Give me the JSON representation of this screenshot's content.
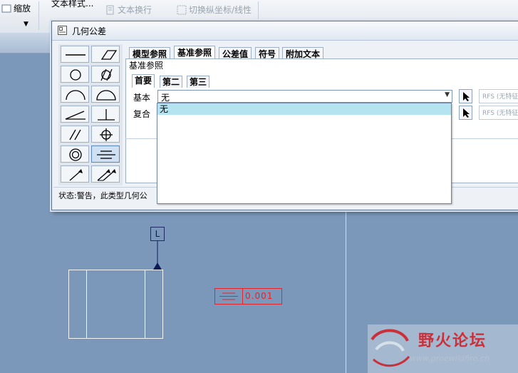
{
  "ribbon": {
    "zoom_label": "缩放",
    "text_style": "文本样式...",
    "text_wrap": "文本换行",
    "toggle_ordinate": "切换纵坐标/线性"
  },
  "dialog": {
    "title": "几何公差",
    "tabs": [
      "模型参照",
      "基准参照",
      "公差值",
      "符号",
      "附加文本"
    ],
    "active_tab": "基准参照",
    "group_label": "基准参照",
    "subtabs": [
      "首要",
      "第二",
      "第三"
    ],
    "active_subtab": "首要",
    "basic_label": "基本",
    "basic_value": "无",
    "composite_label": "复合",
    "rfs_basic": "RFS (无特征)",
    "rfs_composite": "RFS (无特征)",
    "status": "状态:警告，此类型几何公",
    "dropdown_options": [
      "无"
    ],
    "palette_symbols": [
      "straightness-icon",
      "flatness-icon",
      "circularity-icon",
      "cylindricity-icon",
      "line-profile-icon",
      "surface-profile-icon",
      "angularity-icon",
      "perpendicularity-icon",
      "parallelism-icon",
      "position-icon",
      "concentricity-icon",
      "symmetry-icon",
      "circular-runout-icon",
      "total-runout-icon"
    ],
    "selected_symbol": "symmetry-icon"
  },
  "drawing": {
    "datum_label": "L",
    "tolerance_value": "0.001"
  },
  "watermark": {
    "name": "野火论坛",
    "url": "www.proewildfire.cn"
  },
  "colors": {
    "background": "#7b98ba",
    "annotation_red": "#e2242b",
    "datum_blue": "#1c2a66",
    "selection": "#b6e3f0"
  }
}
